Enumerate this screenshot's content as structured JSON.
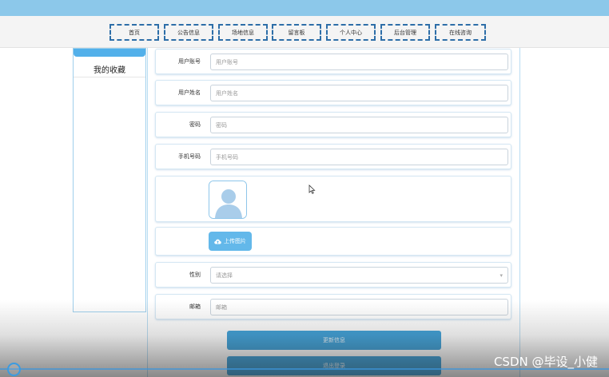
{
  "nav": {
    "items": [
      {
        "label": "首页"
      },
      {
        "label": "公告信息"
      },
      {
        "label": "场地信息"
      },
      {
        "label": "留言板"
      },
      {
        "label": "个人中心"
      },
      {
        "label": "后台管理"
      },
      {
        "label": "在线咨询"
      }
    ]
  },
  "sidebar": {
    "items": [
      {
        "label": "我的收藏"
      }
    ]
  },
  "form": {
    "account": {
      "label": "用户账号",
      "placeholder": "用户账号"
    },
    "name": {
      "label": "用户姓名",
      "placeholder": "用户姓名"
    },
    "password": {
      "label": "密码",
      "placeholder": "密码"
    },
    "phone": {
      "label": "手机号码",
      "placeholder": "手机号码"
    },
    "upload_label": "上传图片",
    "gender": {
      "label": "性别",
      "value": "请选择"
    },
    "email": {
      "label": "邮箱",
      "placeholder": "邮箱"
    }
  },
  "actions": {
    "update_label": "更新信息",
    "logout_label": "退出登录"
  },
  "watermark": "CSDN @毕设_小健",
  "colors": {
    "header": "#8cc8ea",
    "accent": "#3a9fd8",
    "nav_border": "#2d6ea8"
  }
}
